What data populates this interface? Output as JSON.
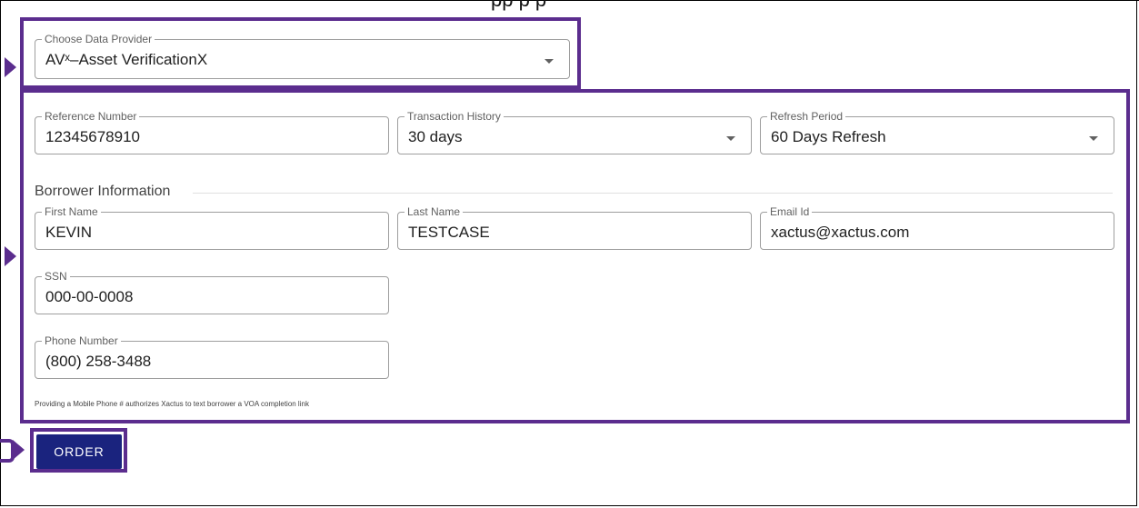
{
  "header": {
    "partial_text": "pp                    p                                  p"
  },
  "provider": {
    "label": "Choose Data Provider",
    "value": "AVˣ–Asset VerificationX"
  },
  "order_fields": {
    "reference": {
      "label": "Reference Number",
      "value": "12345678910"
    },
    "transaction_history": {
      "label": "Transaction History",
      "value": "30 days"
    },
    "refresh_period": {
      "label": "Refresh Period",
      "value": "60 Days Refresh"
    }
  },
  "borrower": {
    "section_title": "Borrower Information",
    "first_name": {
      "label": "First Name",
      "value": "KEVIN"
    },
    "last_name": {
      "label": "Last Name",
      "value": "TESTCASE"
    },
    "email": {
      "label": "Email Id",
      "value": "xactus@xactus.com"
    },
    "ssn": {
      "label": "SSN",
      "value": "000-00-0008"
    },
    "phone": {
      "label": "Phone Number",
      "value": "(800) 258-3488"
    },
    "phone_note": "Providing a Mobile Phone # authorizes Xactus to text borrower a VOA completion link"
  },
  "actions": {
    "order_label": "ORDER"
  },
  "colors": {
    "highlight": "#5b2d8e",
    "button": "#1a237e",
    "field_border": "#9e9e9e"
  }
}
